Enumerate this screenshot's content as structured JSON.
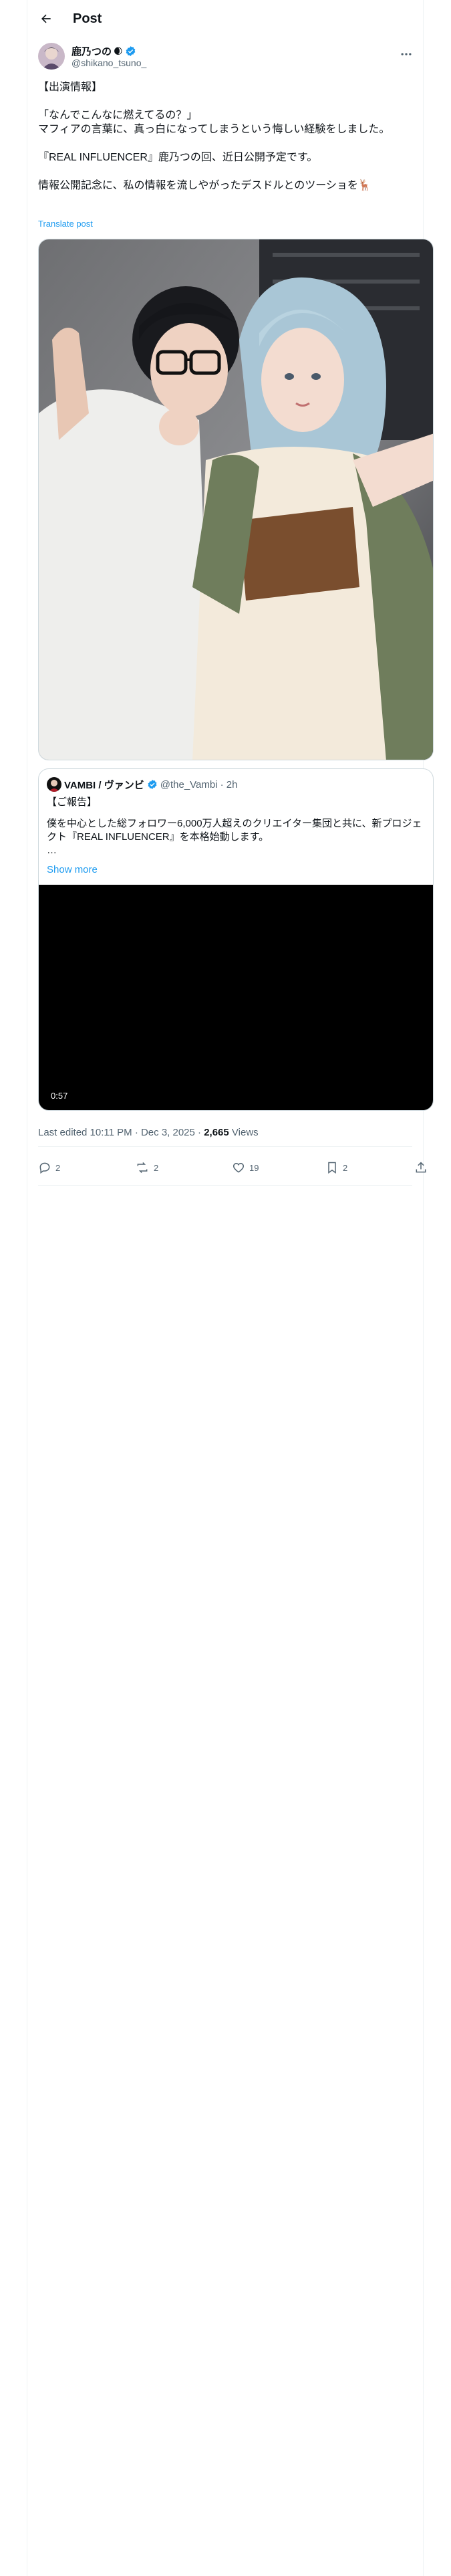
{
  "header": {
    "title": "Post"
  },
  "author": {
    "name": "鹿乃つの",
    "handle": "@shikano_tsuno_"
  },
  "tweet": {
    "lines": [
      "【出演情報】",
      "「なんでこんなに燃えてるの？」",
      "マフィアの言葉に、真っ白になってしまうという悔しい経験をしました。",
      "『REAL INFLUENCER』鹿乃つの回、近日公開予定です。",
      "情報公開記念に、私の情報を流しやがったデスドルとのツーショを🦌"
    ],
    "translate_label": "Translate post"
  },
  "quote": {
    "name": "VAMBI / ヴァンビ",
    "handle": "@the_Vambi",
    "time": "· 2h",
    "line1": "【ご報告】",
    "line2": "僕を中心とした総フォロワー6,000万人超えのクリエイター集団と共に、新プロジェクト『REAL INFLUENCER』を本格始動します。",
    "ellipsis": "…",
    "show_more": "Show more",
    "video_time": "0:57"
  },
  "meta": {
    "edited": "Last edited 10:11 PM · Dec 3, 2025 · ",
    "views_count": "2,665",
    "views_label": " Views"
  },
  "actions": {
    "replies": "2",
    "reposts": "2",
    "likes": "19",
    "bookmarks": "2"
  },
  "colors": {
    "accent": "#1d9bf0",
    "text": "#0f1419",
    "muted": "#536471",
    "border": "#cfd9de"
  }
}
